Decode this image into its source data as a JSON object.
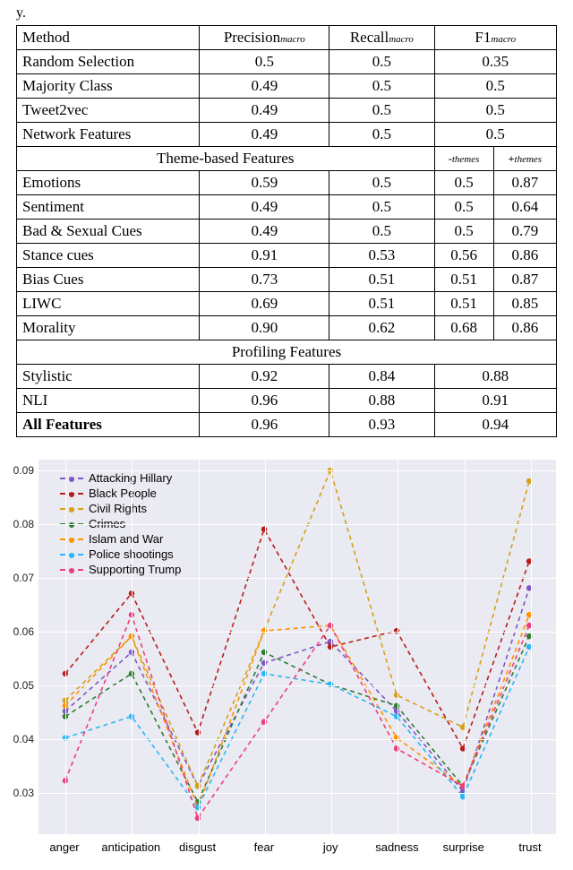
{
  "fragment_text": "y.",
  "table": {
    "headers": {
      "method": "Method",
      "precision": "Precision",
      "recall": "Recall",
      "f1": "F1",
      "sub": "macro",
      "minus_themes": "-themes",
      "plus_themes": "+themes"
    },
    "rows_top": [
      {
        "method": "Random Selection",
        "precision": "0.5",
        "recall": "0.5",
        "f1": "0.35"
      },
      {
        "method": "Majority Class",
        "precision": "0.49",
        "recall": "0.5",
        "f1": "0.5"
      },
      {
        "method": "Tweet2vec",
        "precision": "0.49",
        "recall": "0.5",
        "f1": "0.5"
      },
      {
        "method": "Network Features",
        "precision": "0.49",
        "recall": "0.5",
        "f1": "0.5"
      }
    ],
    "section_theme": "Theme-based Features",
    "rows_theme": [
      {
        "method": "Emotions",
        "precision": "0.59",
        "recall": "0.5",
        "f1m": "0.5",
        "f1p": "0.87"
      },
      {
        "method": "Sentiment",
        "precision": "0.49",
        "recall": "0.5",
        "f1m": "0.5",
        "f1p": "0.64"
      },
      {
        "method": "Bad & Sexual Cues",
        "precision": "0.49",
        "recall": "0.5",
        "f1m": "0.5",
        "f1p": "0.79"
      },
      {
        "method": "Stance cues",
        "precision": "0.91",
        "recall": "0.53",
        "f1m": "0.56",
        "f1p": "0.86"
      },
      {
        "method": "Bias Cues",
        "precision": "0.73",
        "recall": "0.51",
        "f1m": "0.51",
        "f1p": "0.87"
      },
      {
        "method": "LIWC",
        "precision": "0.69",
        "recall": "0.51",
        "f1m": "0.51",
        "f1p": "0.85"
      },
      {
        "method": "Morality",
        "precision": "0.90",
        "recall": "0.62",
        "f1m": "0.68",
        "f1p": "0.86"
      }
    ],
    "section_profiling": "Profiling Features",
    "rows_profiling": [
      {
        "method": "Stylistic",
        "precision": "0.92",
        "recall": "0.84",
        "f1": "0.88"
      },
      {
        "method": "NLI",
        "precision": "0.96",
        "recall": "0.88",
        "f1": "0.91"
      }
    ],
    "row_all": {
      "method": "All Features",
      "precision": "0.96",
      "recall": "0.93",
      "f1": "0.94"
    }
  },
  "chart_data": {
    "type": "line",
    "categories": [
      "anger",
      "anticipation",
      "disgust",
      "fear",
      "joy",
      "sadness",
      "surprise",
      "trust"
    ],
    "ylim": [
      0.022,
      0.092
    ],
    "yticks": [
      0.03,
      0.04,
      0.05,
      0.06,
      0.07,
      0.08,
      0.09
    ],
    "legend_position": "upper-left",
    "series": [
      {
        "name": "Attacking Hillary",
        "color": "#7e57c2",
        "values": [
          0.045,
          0.056,
          0.031,
          0.054,
          0.058,
          0.045,
          0.03,
          0.068
        ]
      },
      {
        "name": "Black People",
        "color": "#b71c1c",
        "values": [
          0.052,
          0.067,
          0.041,
          0.079,
          0.057,
          0.06,
          0.038,
          0.073
        ]
      },
      {
        "name": "Civil Rights",
        "color": "#d4a017",
        "values": [
          0.047,
          0.059,
          0.031,
          0.06,
          0.09,
          0.048,
          0.042,
          0.088
        ]
      },
      {
        "name": "Crimes",
        "color": "#2e7d32",
        "values": [
          0.044,
          0.052,
          0.028,
          0.056,
          0.05,
          0.046,
          0.031,
          0.059
        ]
      },
      {
        "name": "Islam and War",
        "color": "#ff9100",
        "values": [
          0.046,
          0.059,
          0.027,
          0.06,
          0.061,
          0.04,
          0.031,
          0.063
        ]
      },
      {
        "name": "Police shootings",
        "color": "#29b6f6",
        "values": [
          0.04,
          0.044,
          0.027,
          0.052,
          0.05,
          0.044,
          0.029,
          0.057
        ]
      },
      {
        "name": "Supporting Trump",
        "color": "#ec3f7a",
        "values": [
          0.032,
          0.063,
          0.025,
          0.043,
          0.061,
          0.038,
          0.031,
          0.061
        ]
      }
    ]
  }
}
